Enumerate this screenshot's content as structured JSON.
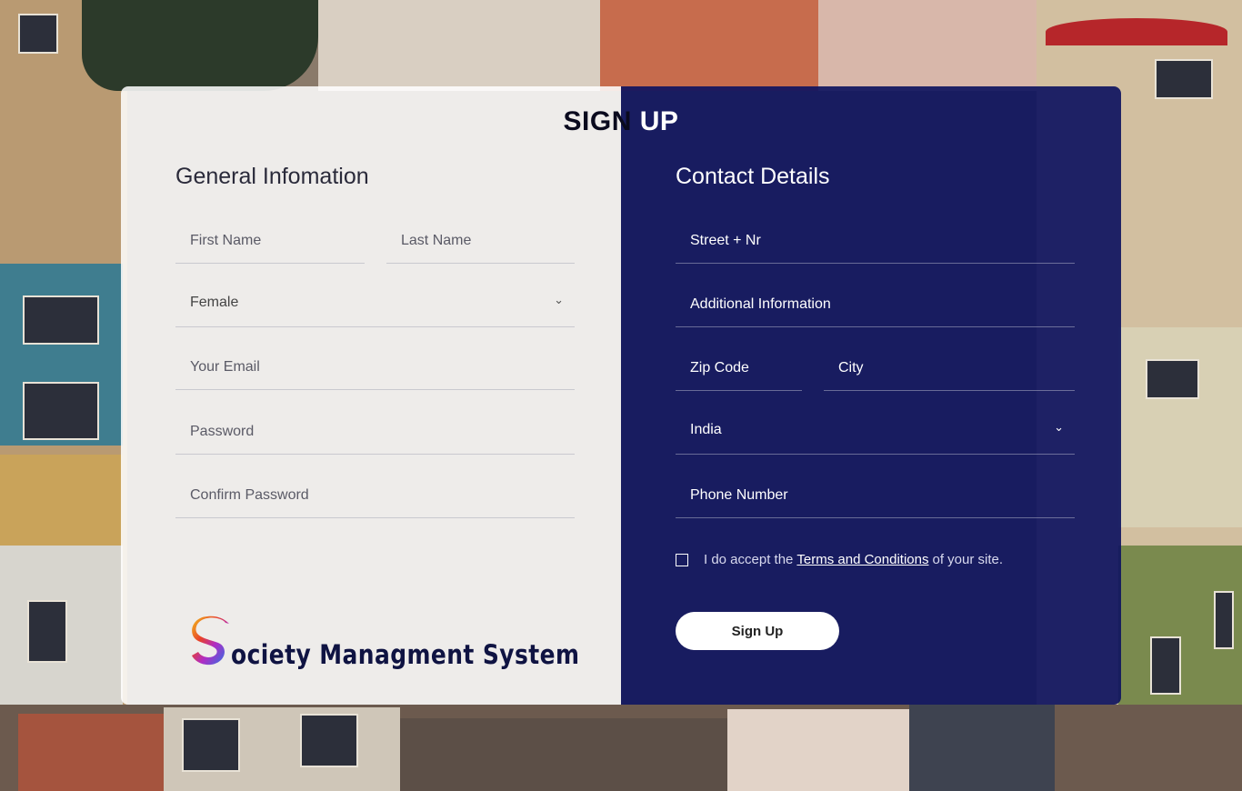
{
  "page": {
    "title_part1": "SIGN",
    "title_part2": "UP"
  },
  "general": {
    "heading": "General Infomation",
    "first_name_placeholder": "First Name",
    "last_name_placeholder": "Last Name",
    "gender_selected": "Female",
    "email_placeholder": "Your Email",
    "password_placeholder": "Password",
    "confirm_password_placeholder": "Confirm Password"
  },
  "contact": {
    "heading": "Contact Details",
    "street_placeholder": "Street + Nr",
    "additional_placeholder": "Additional Information",
    "zip_placeholder": "Zip Code",
    "city_placeholder": "City",
    "country_selected": "India",
    "phone_placeholder": "Phone Number"
  },
  "terms": {
    "prefix": "I do accept the",
    "link": "Terms and Conditions",
    "suffix": "of your site."
  },
  "actions": {
    "signup_label": "Sign Up"
  },
  "logo": {
    "letter": "S",
    "text": "ociety Managment System"
  },
  "colors": {
    "panel_right": "#0e1360",
    "panel_left": "#ffffff",
    "logo_text": "#0f1342"
  }
}
